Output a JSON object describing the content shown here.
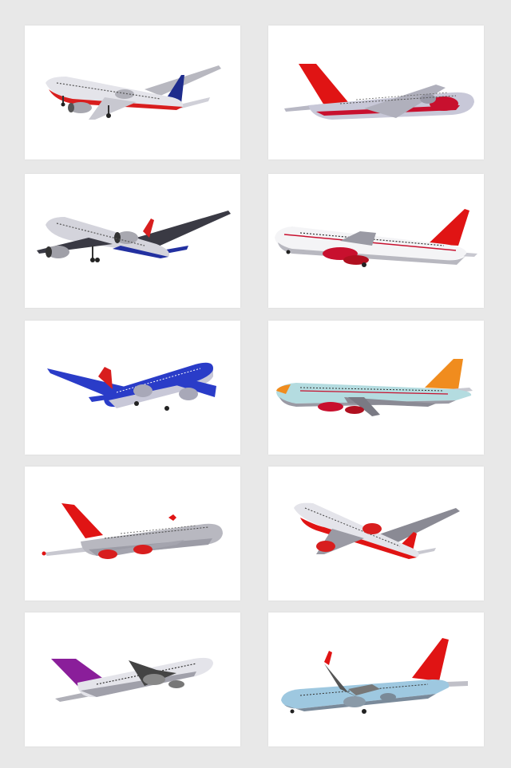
{
  "gallery": {
    "items": [
      {
        "subject": "airliner-red-white-blue-tail",
        "tail_color": "#1e2c8c",
        "accent": "#d81e1e"
      },
      {
        "subject": "airliner-double-deck-red-tail",
        "tail_color": "#e01414",
        "accent": "#c8102e"
      },
      {
        "subject": "airliner-gray-blue-tail",
        "tail_color": "#d81e1e",
        "accent": "#2230a0"
      },
      {
        "subject": "airliner-white-red-tail",
        "tail_color": "#e01414",
        "accent": "#c8102e"
      },
      {
        "subject": "airliner-blue-fuselage",
        "tail_color": "#d81e1e",
        "accent": "#2a3cc8"
      },
      {
        "subject": "airliner-jumbo-orange-tail",
        "tail_color": "#f08c1e",
        "accent": "#c8102e"
      },
      {
        "subject": "airliner-double-deck-gray-red-tail",
        "tail_color": "#e01414",
        "accent": "#d81e1e"
      },
      {
        "subject": "airliner-red-belly-banking",
        "tail_color": "#e01414",
        "accent": "#e01414"
      },
      {
        "subject": "airliner-purple-tail",
        "tail_color": "#8a1e9a",
        "accent": "#444444"
      },
      {
        "subject": "airliner-lightblue-red-tail",
        "tail_color": "#e01414",
        "accent": "#9ec8e0"
      }
    ]
  }
}
